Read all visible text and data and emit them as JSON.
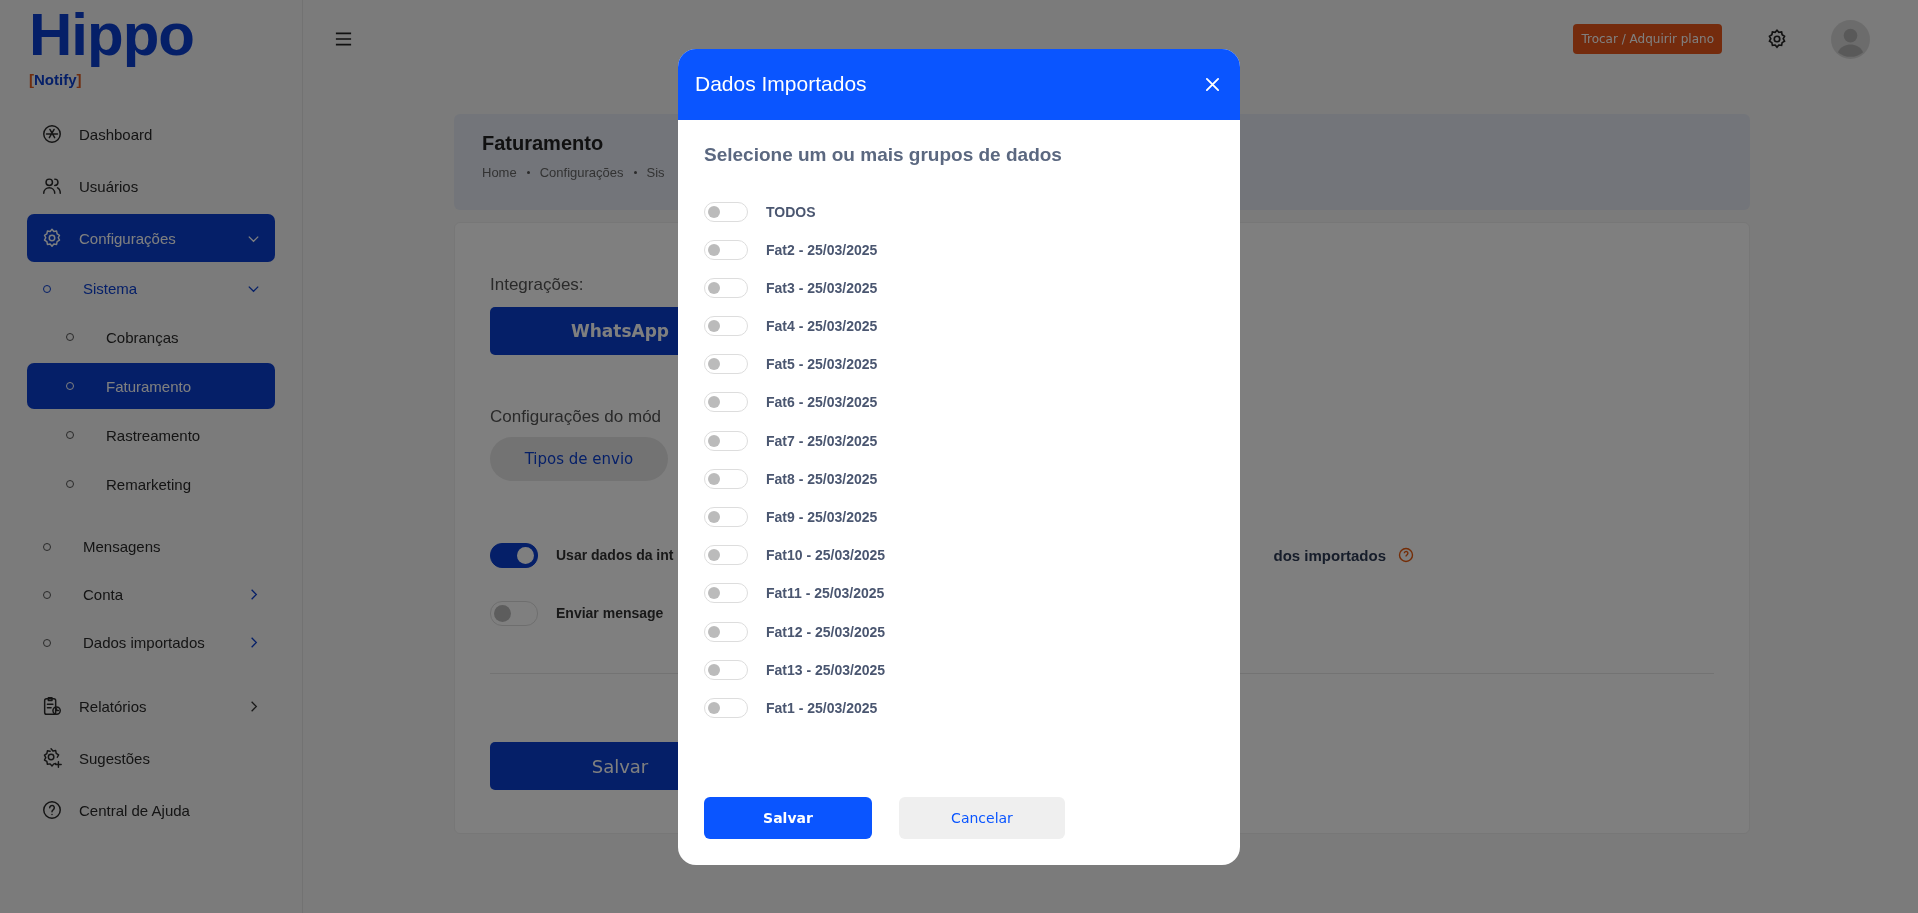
{
  "logo": {
    "name": "Hippo",
    "tagline": "[Notify]"
  },
  "sidebar": {
    "items": [
      {
        "label": "Dashboard",
        "selected": false
      },
      {
        "label": "Usuários",
        "selected": false
      },
      {
        "label": "Configurações",
        "selected": true,
        "expanded": true,
        "children": [
          {
            "label": "Sistema",
            "selected": true,
            "expanded": true,
            "children": [
              {
                "label": "Cobranças",
                "selected": false
              },
              {
                "label": "Faturamento",
                "selected": true
              },
              {
                "label": "Rastreamento",
                "selected": false
              },
              {
                "label": "Remarketing",
                "selected": false
              }
            ]
          },
          {
            "label": "Mensagens",
            "selected": false
          },
          {
            "label": "Conta",
            "selected": false,
            "expanded": false
          },
          {
            "label": "Dados importados",
            "selected": false,
            "expanded": false
          }
        ]
      },
      {
        "label": "Relatórios",
        "selected": false,
        "expanded": false
      },
      {
        "label": "Sugestões",
        "selected": false
      },
      {
        "label": "Central de Ajuda",
        "selected": false
      }
    ]
  },
  "topbar": {
    "plan_button": "Trocar / Adquirir plano"
  },
  "page_header": {
    "title": "Faturamento",
    "breadcrumb": [
      "Home",
      "Configurações",
      "Sis"
    ]
  },
  "content": {
    "integrations_label": "Integrações:",
    "integration_button": "WhatsApp",
    "module_label": "Configurações do mód",
    "types_button": "Tipos de envio",
    "toggles": [
      {
        "label": "Usar dados da int",
        "on": true
      },
      {
        "label": "Enviar mensage",
        "on": false
      }
    ],
    "right_fragment": "dos importados",
    "save_button": "Salvar"
  },
  "modal": {
    "title": "Dados Importados",
    "subtitle": "Selecione um ou mais grupos de dados",
    "options": [
      {
        "label": "TODOS",
        "on": false
      },
      {
        "label": "Fat2 - 25/03/2025",
        "on": false
      },
      {
        "label": "Fat3 - 25/03/2025",
        "on": false
      },
      {
        "label": "Fat4 - 25/03/2025",
        "on": false
      },
      {
        "label": "Fat5 - 25/03/2025",
        "on": false
      },
      {
        "label": "Fat6 - 25/03/2025",
        "on": false
      },
      {
        "label": "Fat7 - 25/03/2025",
        "on": false
      },
      {
        "label": "Fat8 - 25/03/2025",
        "on": false
      },
      {
        "label": "Fat9 - 25/03/2025",
        "on": false
      },
      {
        "label": "Fat10 - 25/03/2025",
        "on": false
      },
      {
        "label": "Fat11 - 25/03/2025",
        "on": false
      },
      {
        "label": "Fat12 - 25/03/2025",
        "on": false
      },
      {
        "label": "Fat13 - 25/03/2025",
        "on": false
      },
      {
        "label": "Fat1 - 25/03/2025",
        "on": false
      }
    ],
    "save_button": "Salvar",
    "cancel_button": "Cancelar"
  }
}
